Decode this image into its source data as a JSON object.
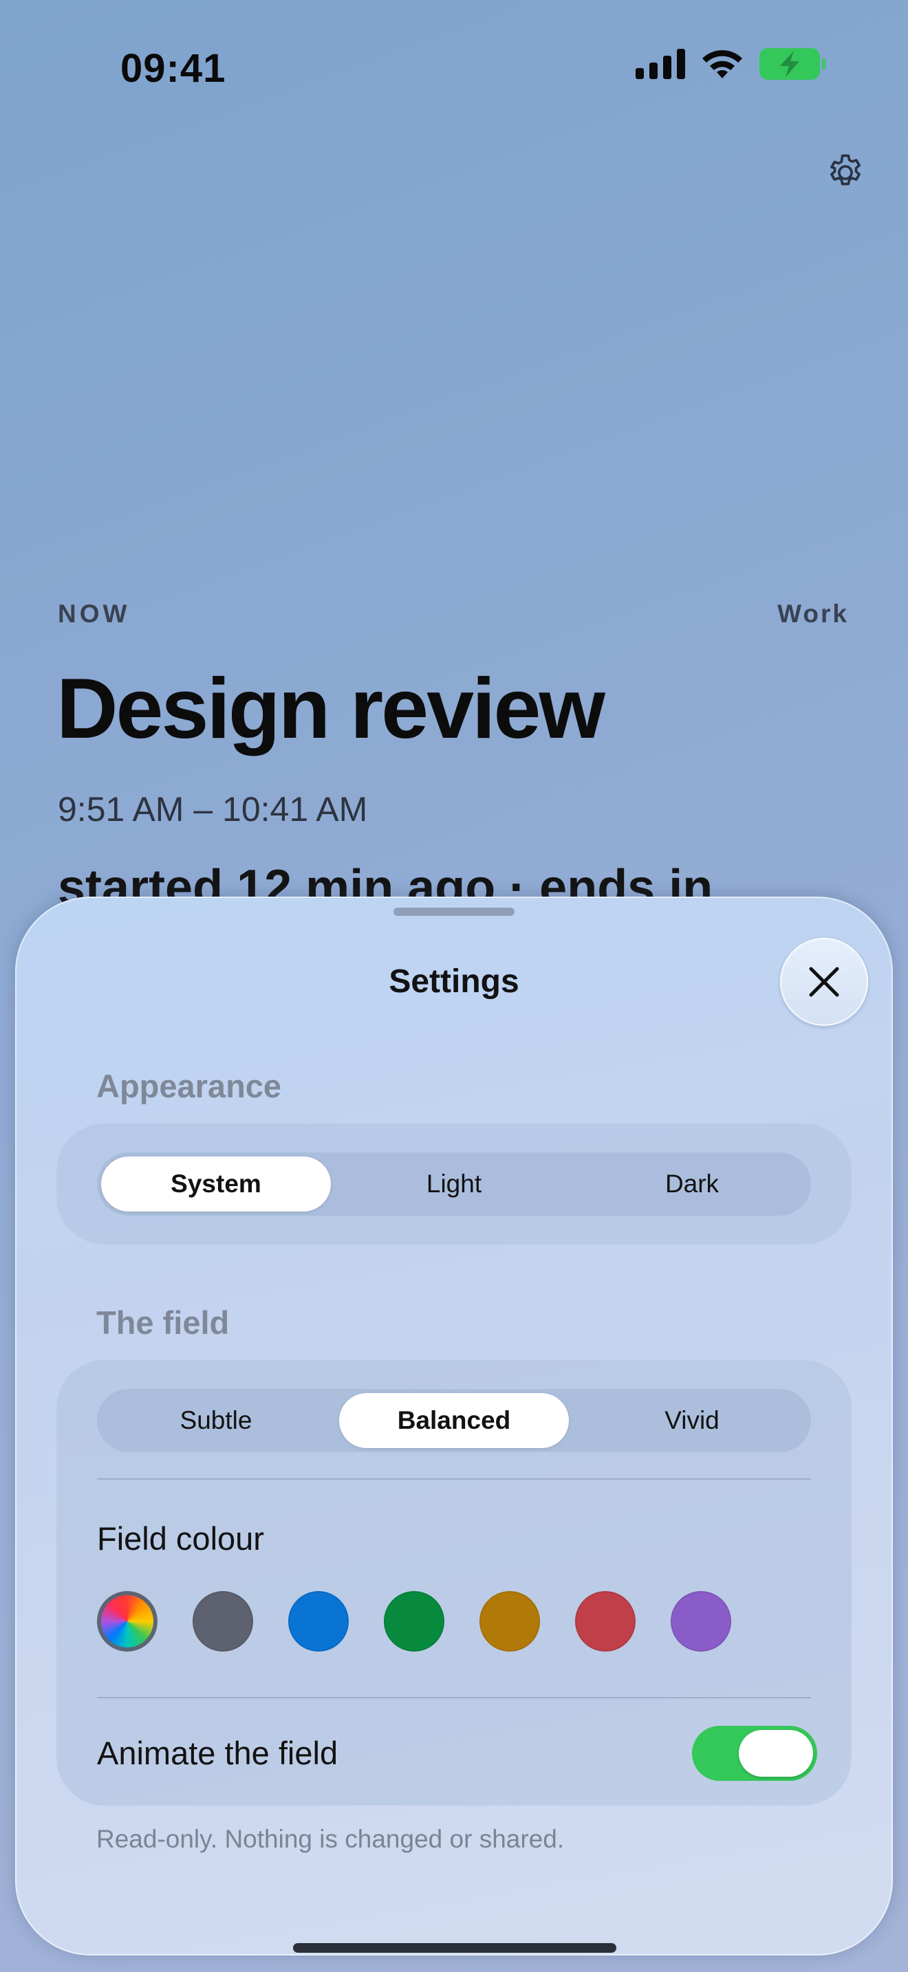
{
  "status_bar": {
    "time": "09:41",
    "icons": [
      "signal-icon",
      "wifi-icon",
      "battery-charging-icon"
    ],
    "battery_color": "#34c759"
  },
  "header": {
    "settings_icon": "gear-icon"
  },
  "current_event": {
    "now_label": "NOW",
    "category": "Work",
    "title": "Design review",
    "time_range": "9:51 AM – 10:41 AM",
    "status": "started 12 min ago · ends in"
  },
  "settings_sheet": {
    "title": "Settings",
    "close_icon": "close-icon",
    "appearance": {
      "label": "Appearance",
      "options": [
        "System",
        "Light",
        "Dark"
      ],
      "selected": "System"
    },
    "field": {
      "label": "The field",
      "intensity_options": [
        "Subtle",
        "Balanced",
        "Vivid"
      ],
      "selected_intensity": "Balanced",
      "colour_label": "Field colour",
      "colours": [
        {
          "name": "multicolor",
          "value": "conic"
        },
        {
          "name": "gray",
          "value": "#5e6270"
        },
        {
          "name": "blue",
          "value": "#0a74d4"
        },
        {
          "name": "green",
          "value": "#088a3e"
        },
        {
          "name": "amber",
          "value": "#b17a08"
        },
        {
          "name": "red",
          "value": "#c0404a"
        },
        {
          "name": "purple",
          "value": "#8a5cc8"
        }
      ],
      "selected_colour": "multicolor",
      "animate_label": "Animate the field",
      "animate_on": true
    },
    "footnote": "Read-only. Nothing is changed or shared."
  }
}
